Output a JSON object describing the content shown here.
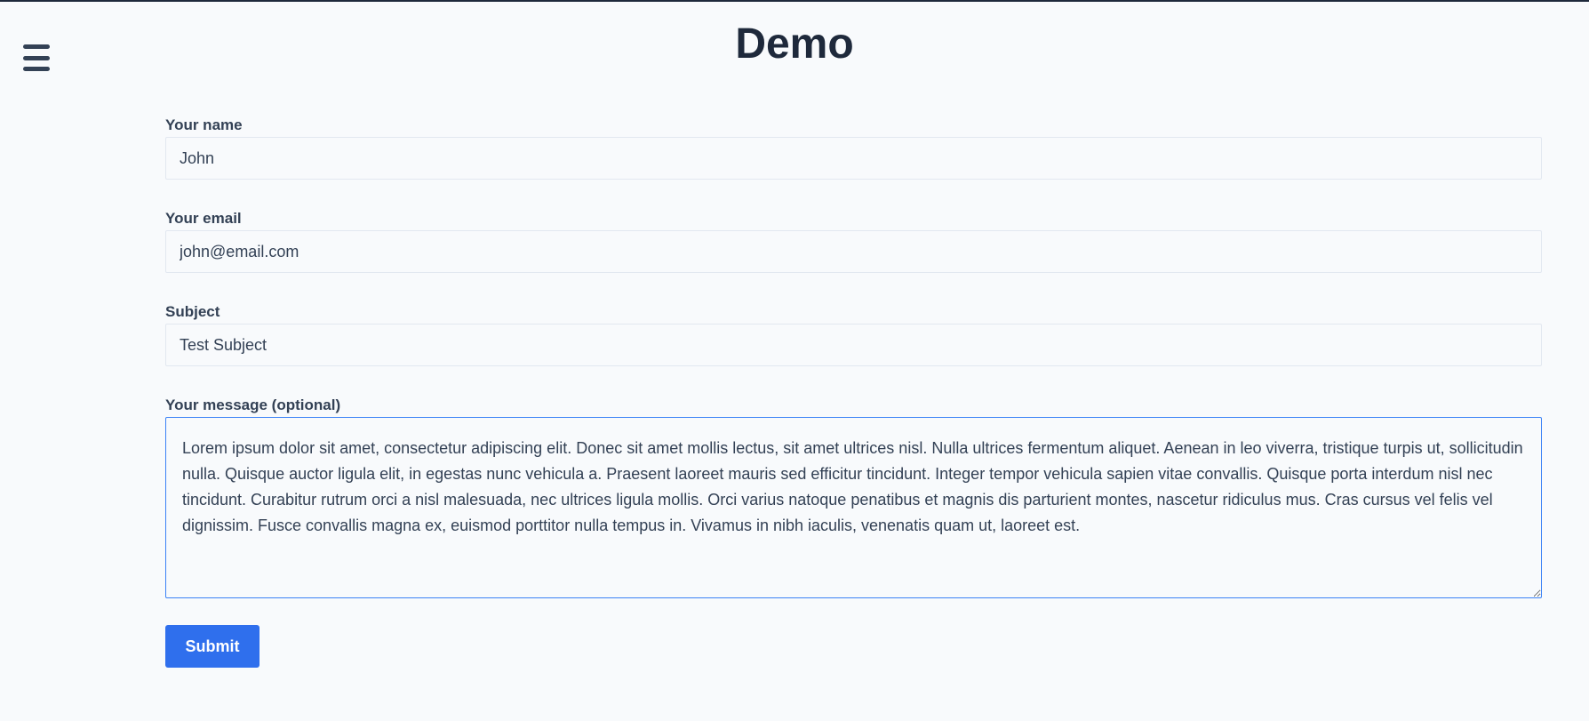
{
  "header": {
    "title": "Demo",
    "menu_icon": "hamburger-menu-icon"
  },
  "form": {
    "name": {
      "label": "Your name",
      "value": "John"
    },
    "email": {
      "label": "Your email",
      "value": "john@email.com"
    },
    "subject": {
      "label": "Subject",
      "value": "Test Subject"
    },
    "message": {
      "label": "Your message (optional)",
      "value": "Lorem ipsum dolor sit amet, consectetur adipiscing elit. Donec sit amet mollis lectus, sit amet ultrices nisl. Nulla ultrices fermentum aliquet. Aenean in leo viverra, tristique turpis ut, sollicitudin nulla. Quisque auctor ligula elit, in egestas nunc vehicula a. Praesent laoreet mauris sed efficitur tincidunt. Integer tempor vehicula sapien vitae convallis. Quisque porta interdum nisl nec tincidunt. Curabitur rutrum orci a nisl malesuada, nec ultrices ligula mollis. Orci varius natoque penatibus et magnis dis parturient montes, nascetur ridiculus mus. Cras cursus vel felis vel dignissim. Fusce convallis magna ex, euismod porttitor nulla tempus in. Vivamus in nibh iaculis, venenatis quam ut, laoreet est."
    },
    "submit_label": "Submit"
  },
  "colors": {
    "background": "#f8fafc",
    "title": "#1e293b",
    "text": "#334155",
    "accent": "#2f6fed",
    "focus_border": "#3b82f6"
  }
}
